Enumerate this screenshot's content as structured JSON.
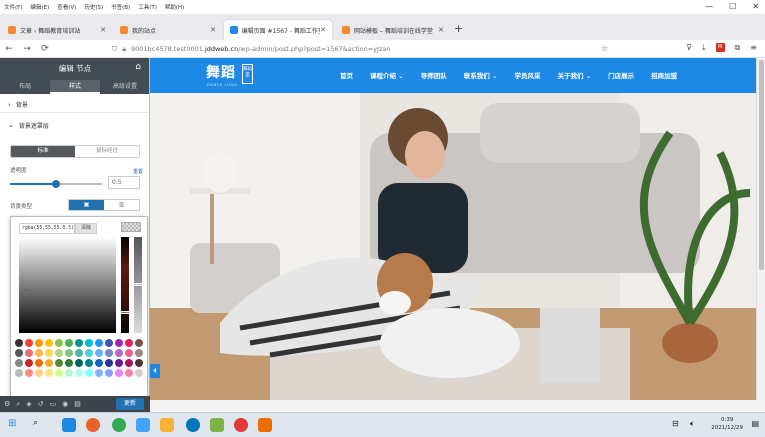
{
  "menubar": {
    "items": [
      "文件(F)",
      "编辑(E)",
      "查看(V)",
      "历史(S)",
      "书签(B)",
      "工具(T)",
      "帮助(H)"
    ],
    "win_min": "—",
    "win_max": "☐",
    "win_close": "✕"
  },
  "tabs": [
    {
      "title": "文章 ‹ 舞蹈教育培训站",
      "fav_color": "#f28b2d"
    },
    {
      "title": "我的站点",
      "fav_color": "#f28b2d"
    },
    {
      "title": "编辑页面 #1567 - 舞蹈工作室",
      "fav_color": "#1e88e5"
    },
    {
      "title": "网站模板 – 舞蹈培训在线学堂",
      "fav_color": "#f28b2d"
    }
  ],
  "newtab": "+",
  "nav": {
    "back": "←",
    "forward": "→",
    "reload": "⟳",
    "url_prefix": "9001bc4578.test0001.",
    "url_domain": "jddweb.cn",
    "url_path": "/wp-admin/post.php?post=1567&action=yjzan"
  },
  "editor": {
    "title": "编辑 节点",
    "tabs": [
      "布局",
      "样式",
      "高级设置"
    ],
    "section_bg": "背景",
    "section_bg_layer": "背景遮罩层",
    "state_tabs": [
      "标准",
      "鼠标经过"
    ],
    "opacity_label": "透明度",
    "opacity_value": "0.5",
    "opacity_fraction": 0.5,
    "reset_label": "重置",
    "bg_type_label": "背景类型",
    "picker": {
      "rgba": "rgba(55,55,55,0.5)",
      "clear": "清除"
    },
    "update_label": "更新"
  },
  "site": {
    "logo": "舞蹈",
    "logo_sub": "DANCE LOGO",
    "logo_badge": "舞蹈室",
    "nav": [
      "首页",
      "课程介绍 ⌄",
      "导师团队",
      "联系我们 ⌄",
      "学员风采",
      "关于我们 ⌄",
      "门店展示",
      "招商加盟"
    ]
  },
  "taskbar": {
    "time": "0:39",
    "date": "2021/12/29"
  },
  "colors": {
    "accent": "#1e88e5",
    "panel_dark": "#444c53",
    "wp_blue": "#2271b1"
  }
}
